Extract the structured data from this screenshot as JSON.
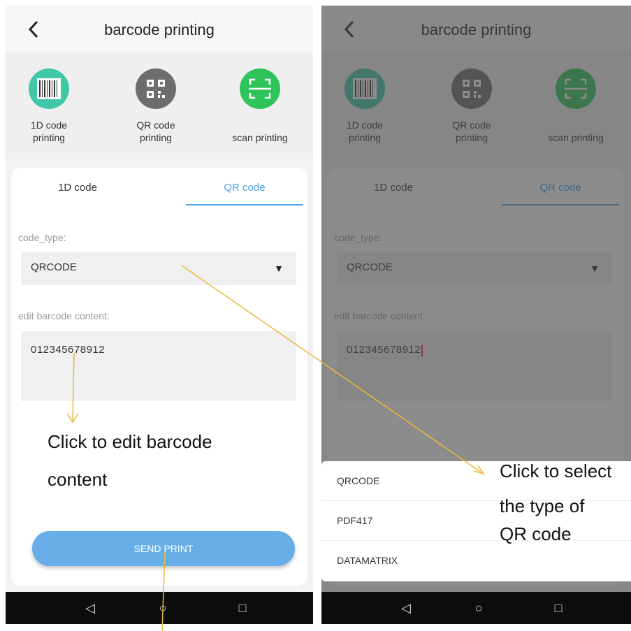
{
  "app": {
    "title": "barcode printing"
  },
  "modes": [
    {
      "label_line1": "1D code",
      "label_line2": "printing",
      "icon": "barcode-icon",
      "color": "#3fc7a8"
    },
    {
      "label_line1": "QR code",
      "label_line2": "printing",
      "icon": "qr-code-icon",
      "color": "#6d6d6d"
    },
    {
      "label_line1": "scan printing",
      "label_line2": "",
      "icon": "scan-icon",
      "color": "#2fc45a"
    }
  ],
  "tabs": [
    {
      "label": "1D code"
    },
    {
      "label": "QR code",
      "active": true
    }
  ],
  "form": {
    "code_type_label": "code_type:",
    "code_type_value": "QRCODE",
    "content_label": "edit barcode content:",
    "content_value": "012345678912"
  },
  "send_button": "SEND PRINT",
  "dropdown_options": [
    "QRCODE",
    "PDF417",
    "DATAMATRIX"
  ],
  "annotations": {
    "edit_line1": "Click to edit barcode",
    "edit_line2": "content",
    "select_line1": "Click to select",
    "select_line2": "the type of",
    "select_line3": "QR code"
  },
  "colors": {
    "accent": "#4a9fe6",
    "button": "#67aee8",
    "arrow": "#e8b93a"
  }
}
